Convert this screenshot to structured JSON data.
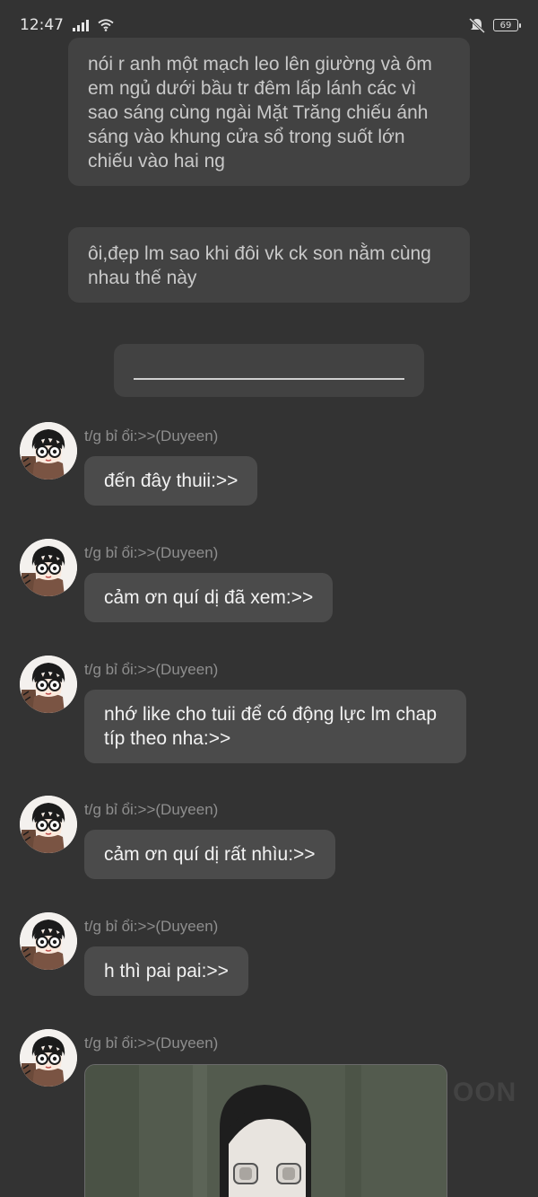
{
  "status_bar": {
    "time": "12:47",
    "battery": "69",
    "icons": [
      "signal-icon",
      "wifi-icon",
      "mute-icon",
      "battery-icon"
    ]
  },
  "narration": [
    "nói r anh một mạch leo lên giường và ôm em ngủ dưới bầu tr đêm lấp lánh các vì sao sáng cùng ngài Mặt Trăng chiếu ánh sáng vào khung cửa sổ trong suốt lớn chiếu vào hai ng",
    "ôi,đẹp lm sao khi đôi vk ck son nằm cùng nhau thế này"
  ],
  "messages": [
    {
      "sender": "t/g bỉ ổi:>>(Duyeen)",
      "text": "đến đây thuii:>>"
    },
    {
      "sender": "t/g bỉ ổi:>>(Duyeen)",
      "text": "cảm ơn quí dị đã xem:>>"
    },
    {
      "sender": "t/g bỉ ổi:>>(Duyeen)",
      "text": "nhớ like cho tuii để có động lực lm chap típ theo nha:>>"
    },
    {
      "sender": "t/g bỉ ổi:>>(Duyeen)",
      "text": "cảm ơn quí dị rất nhìu:>>"
    },
    {
      "sender": "t/g bỉ ổi:>>(Duyeen)",
      "text": "h thì pai pai:>>"
    },
    {
      "sender": "t/g bỉ ổi:>>(Duyeen)",
      "text": ""
    }
  ],
  "watermark": "OON",
  "colors": {
    "background": "#333333",
    "narration_bubble": "#424242",
    "message_bubble": "#4b4b4b",
    "sender_text": "#8e8e8e"
  }
}
